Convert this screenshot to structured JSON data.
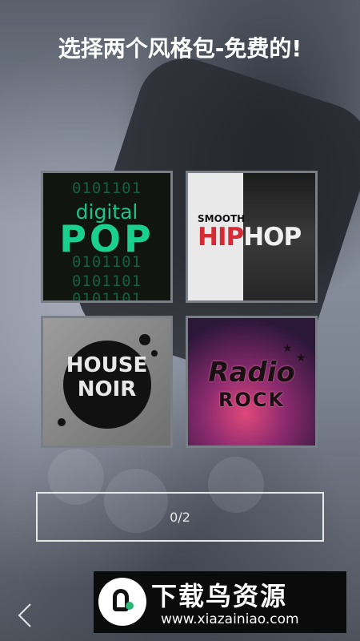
{
  "title": "选择两个风格包-免费的!",
  "packs": [
    {
      "name": "digital POP",
      "line1": "digital",
      "line2": "POP",
      "binary": [
        "0101101",
        "0101101",
        "0101101",
        "0101101",
        "0101101"
      ]
    },
    {
      "name": "SMOOTH HIPHOP",
      "line1": "SMOOTH",
      "line2a": "HIP",
      "line2b": "HOP"
    },
    {
      "name": "HOUSE NOIR",
      "line1": "HOUSE",
      "line2": "NOIR"
    },
    {
      "name": "Radio ROCK",
      "line1": "Radio",
      "line2": "ROCK"
    }
  ],
  "counter": "0/2",
  "watermark": {
    "title": "下载鸟资源",
    "url": "www.xiazainiao.com"
  },
  "icons": {
    "back": "chevron-left-icon"
  },
  "colors": {
    "text": "#ffffff",
    "tile_border": "#7a7e86",
    "pop_green": "#19d08f",
    "hiphop_red": "#d52b36"
  }
}
